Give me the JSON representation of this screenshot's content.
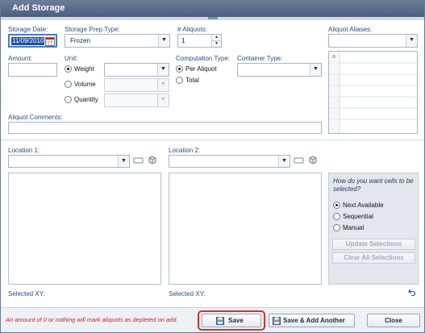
{
  "window": {
    "title": "Add Storage"
  },
  "storage_date": {
    "label": "Storage Date:",
    "value": "11/09/2010"
  },
  "storage_prep_type": {
    "label": "Storage Prep Type:",
    "value": "Frozen"
  },
  "aliquots": {
    "label": "# Aliquots:",
    "value": "1"
  },
  "aliquot_aliases": {
    "label": "Aliquot Aliases:",
    "grid_first_row": "a"
  },
  "amount": {
    "label": "Amount:",
    "value": ""
  },
  "unit": {
    "label": "Unit:",
    "options": [
      "Weight",
      "Volume",
      "Quantity"
    ],
    "selected": "Weight"
  },
  "computation_type": {
    "label": "Computation Type:",
    "options": [
      "Per Aliquot",
      "Total"
    ],
    "selected": "Per Aliquot"
  },
  "container_type": {
    "label": "Container Type:",
    "value": ""
  },
  "aliquot_comments": {
    "label": "Aliquot Comments:",
    "value": ""
  },
  "location1": {
    "label": "Location 1:",
    "selected_xy_label": "Selected XY:"
  },
  "location2": {
    "label": "Location 2:",
    "selected_xy_label": "Selected XY:"
  },
  "cell_selection": {
    "question": "How do you want cells to be selected?",
    "options": [
      "Next Available",
      "Sequential",
      "Manual"
    ],
    "selected": "Next Available",
    "update_button": "Update Selections",
    "clear_button": "Clear All Selections"
  },
  "footer": {
    "message": "An amount of 0 or nothing will mark aliquots as depleted on add.",
    "save": "Save",
    "save_add_another": "Save & Add Another",
    "close": "Close"
  },
  "icons": [
    "calendar-icon",
    "chevron-down-icon",
    "spin-up-icon",
    "spin-down-icon",
    "tag-icon",
    "cube-icon",
    "undo-icon",
    "save-icon"
  ],
  "colors": {
    "titlebar": "#5a6f8f",
    "label": "#2a4d84",
    "warning": "#d01f1f",
    "highlight_ring": "#d0342c",
    "selection": "#1c4fb3"
  }
}
